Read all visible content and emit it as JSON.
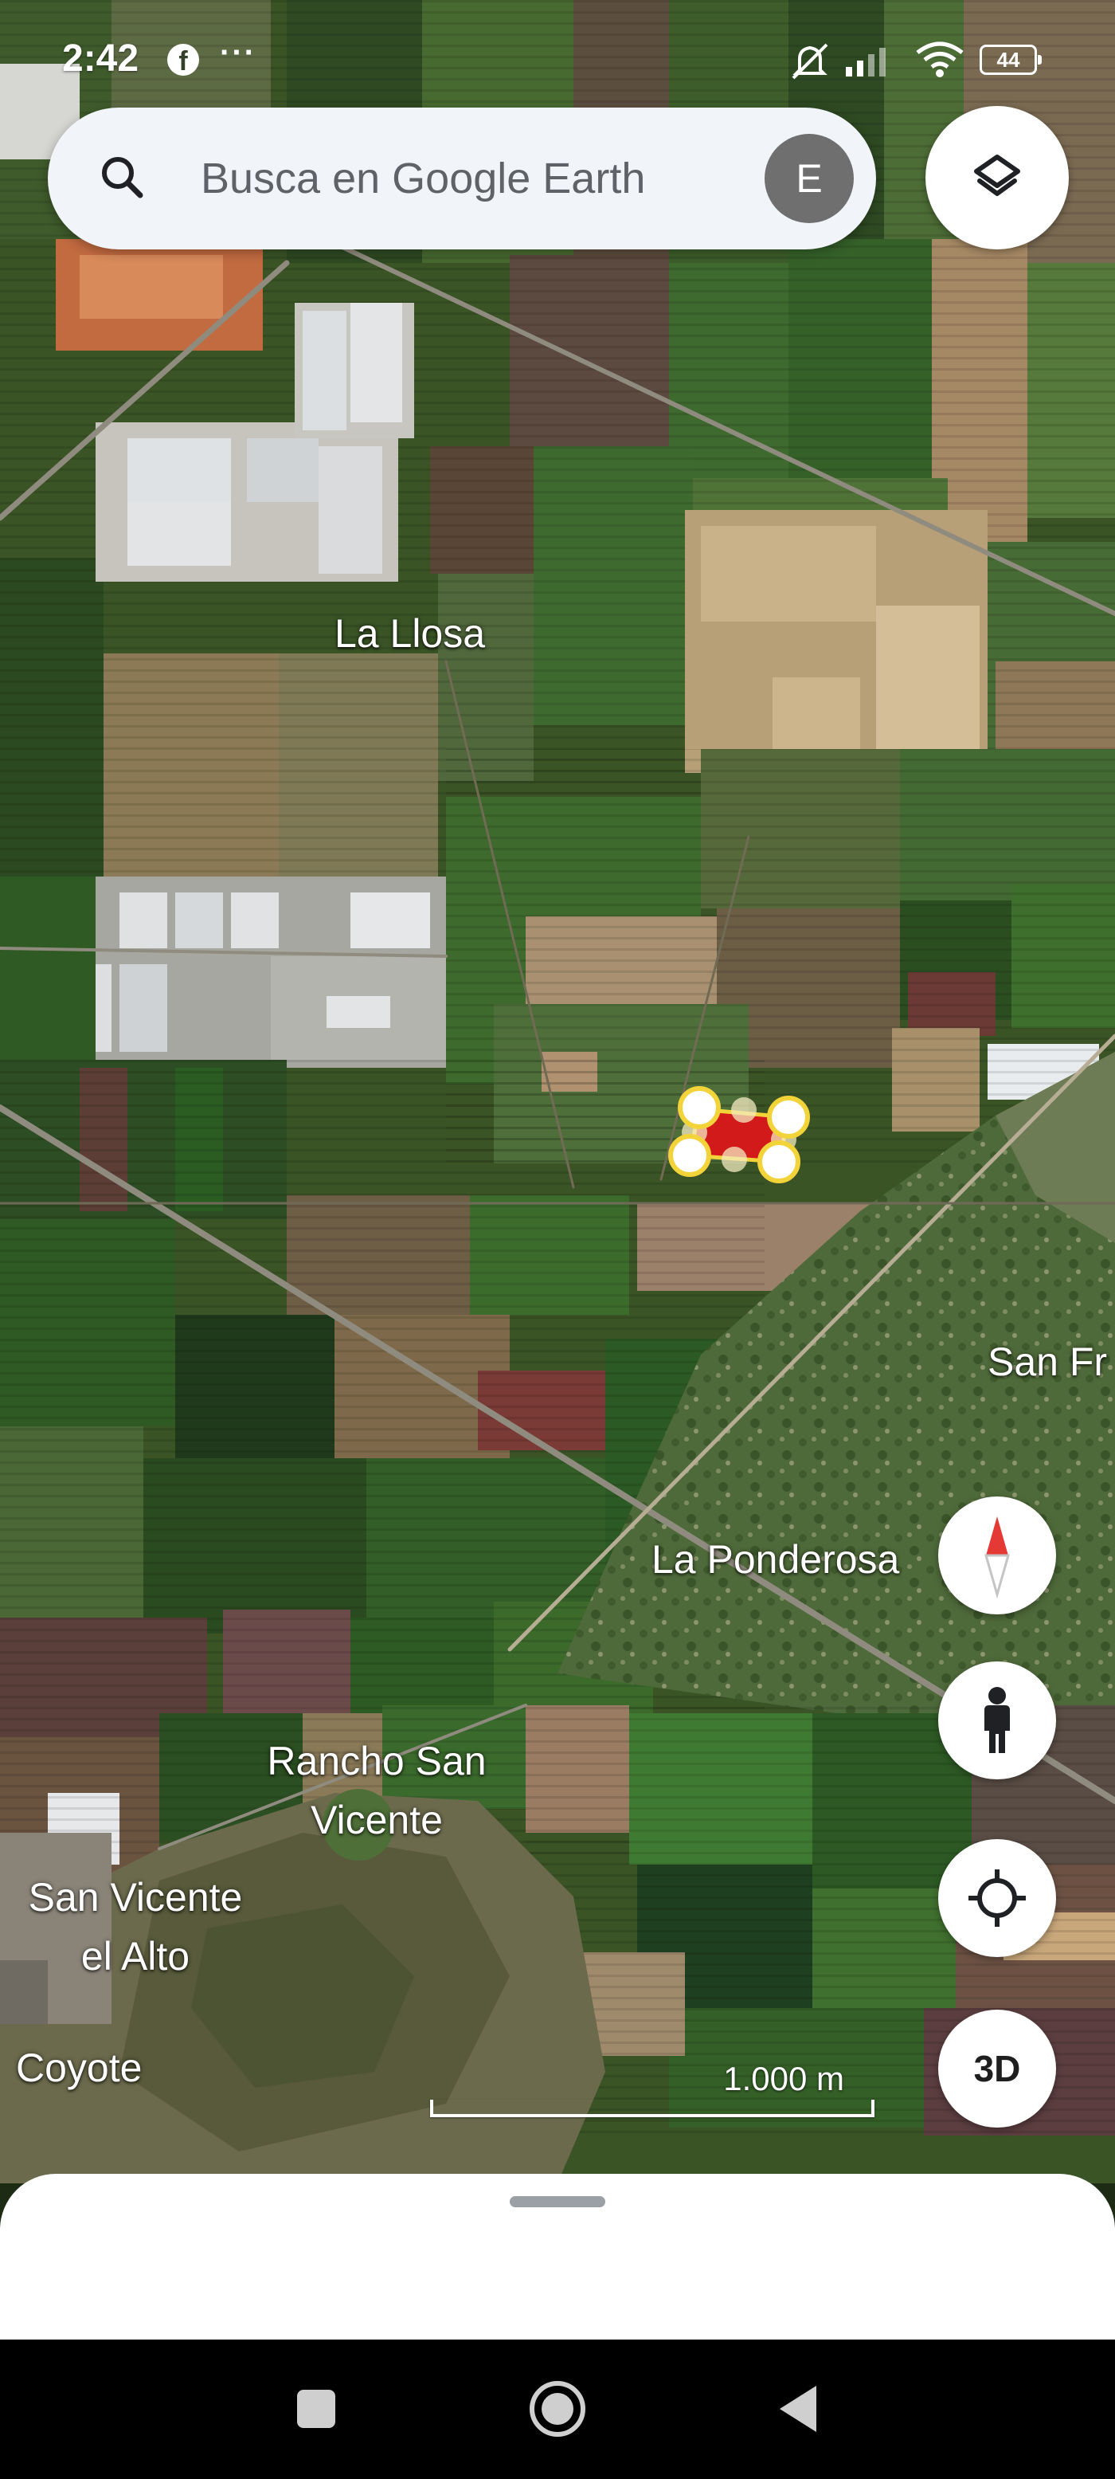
{
  "status_bar": {
    "time": "2:42",
    "facebook_icon": "facebook-icon",
    "more_indicator": "···",
    "battery_level": "44",
    "icons": [
      "mute-icon",
      "signal-icon",
      "wifi-icon",
      "battery-icon"
    ]
  },
  "search": {
    "placeholder": "Busca en Google Earth",
    "value": "",
    "avatar_initial": "E",
    "icon": "search-icon"
  },
  "map": {
    "labels": {
      "la_llosa": "La Llosa",
      "san_fr": "San Fr",
      "la_ponderosa": "La Ponderosa",
      "rancho_san_vicente_line1": "Rancho San",
      "rancho_san_vicente_line2": "Vicente",
      "san_vicente_el_alto_line1": "San Vicente",
      "san_vicente_el_alto_line2": "el Alto",
      "coyote": "Coyote"
    },
    "polygon": {
      "fill_color": "#d21a1a",
      "vertex_color": "#f3d33a",
      "vertex_count": 4,
      "midpoint_count": 4
    },
    "scale": {
      "label": "1.000 m"
    }
  },
  "controls": {
    "layers": "layers-icon",
    "compass": "compass-icon",
    "street_view": "pegman-icon",
    "my_location": "my-location-icon",
    "view_3d_label": "3D"
  },
  "nav_bar": {
    "recents": "recents-icon",
    "home": "home-icon",
    "back": "back-icon"
  },
  "colors": {
    "search_bg": "#f1f4f9",
    "avatar_bg": "#6f6f6f",
    "compass_red": "#e53935",
    "polygon_red": "#d21a1a",
    "vertex_yellow": "#f3d33a"
  }
}
